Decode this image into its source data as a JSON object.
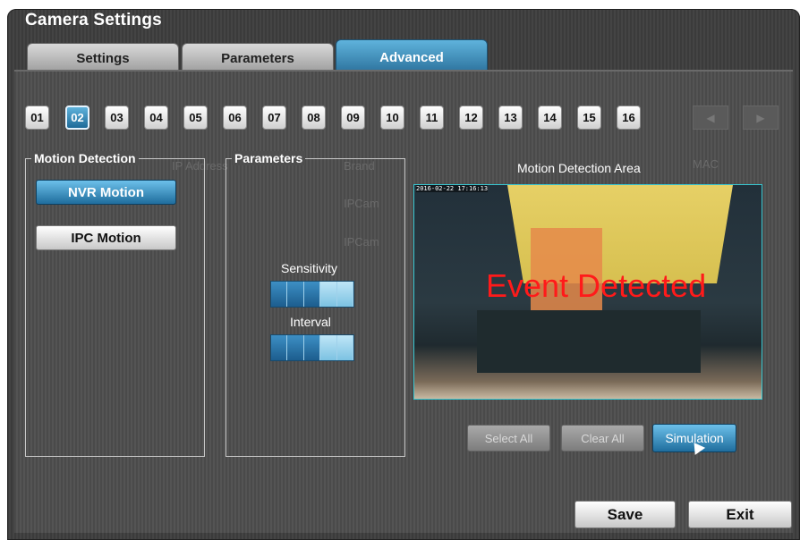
{
  "window": {
    "title": "Camera Settings"
  },
  "tabs": [
    {
      "label": "Settings",
      "active": false
    },
    {
      "label": "Parameters",
      "active": false
    },
    {
      "label": "Advanced",
      "active": true
    }
  ],
  "channels": {
    "items": [
      "01",
      "02",
      "03",
      "04",
      "05",
      "06",
      "07",
      "08",
      "09",
      "10",
      "11",
      "12",
      "13",
      "14",
      "15",
      "16"
    ],
    "selected": "02"
  },
  "background_table": {
    "headers": [
      "IP Address",
      "Brand",
      "MAC"
    ],
    "brand_cells": [
      "IPCam",
      "IPCam"
    ]
  },
  "motion_detection": {
    "legend": "Motion Detection",
    "nvr_button": "NVR Motion",
    "ipc_button": "IPC Motion",
    "selected": "NVR Motion"
  },
  "parameters": {
    "legend": "Parameters",
    "sensitivity_label": "Sensitivity",
    "sensitivity_level": 3,
    "interval_label": "Interval",
    "interval_level": 3,
    "max_level": 5
  },
  "area": {
    "title": "Motion Detection Area",
    "timestamp": "2016-02-22 17:16:13",
    "event_text": "Event Detected",
    "buttons": {
      "select_all": "Select All",
      "clear_all": "Clear All",
      "simulation": "Simulation"
    }
  },
  "footer": {
    "save": "Save",
    "exit": "Exit"
  },
  "colors": {
    "accent": "#2a7fb5",
    "event_text": "#ff1a1a",
    "area_border": "#38c6d0"
  }
}
